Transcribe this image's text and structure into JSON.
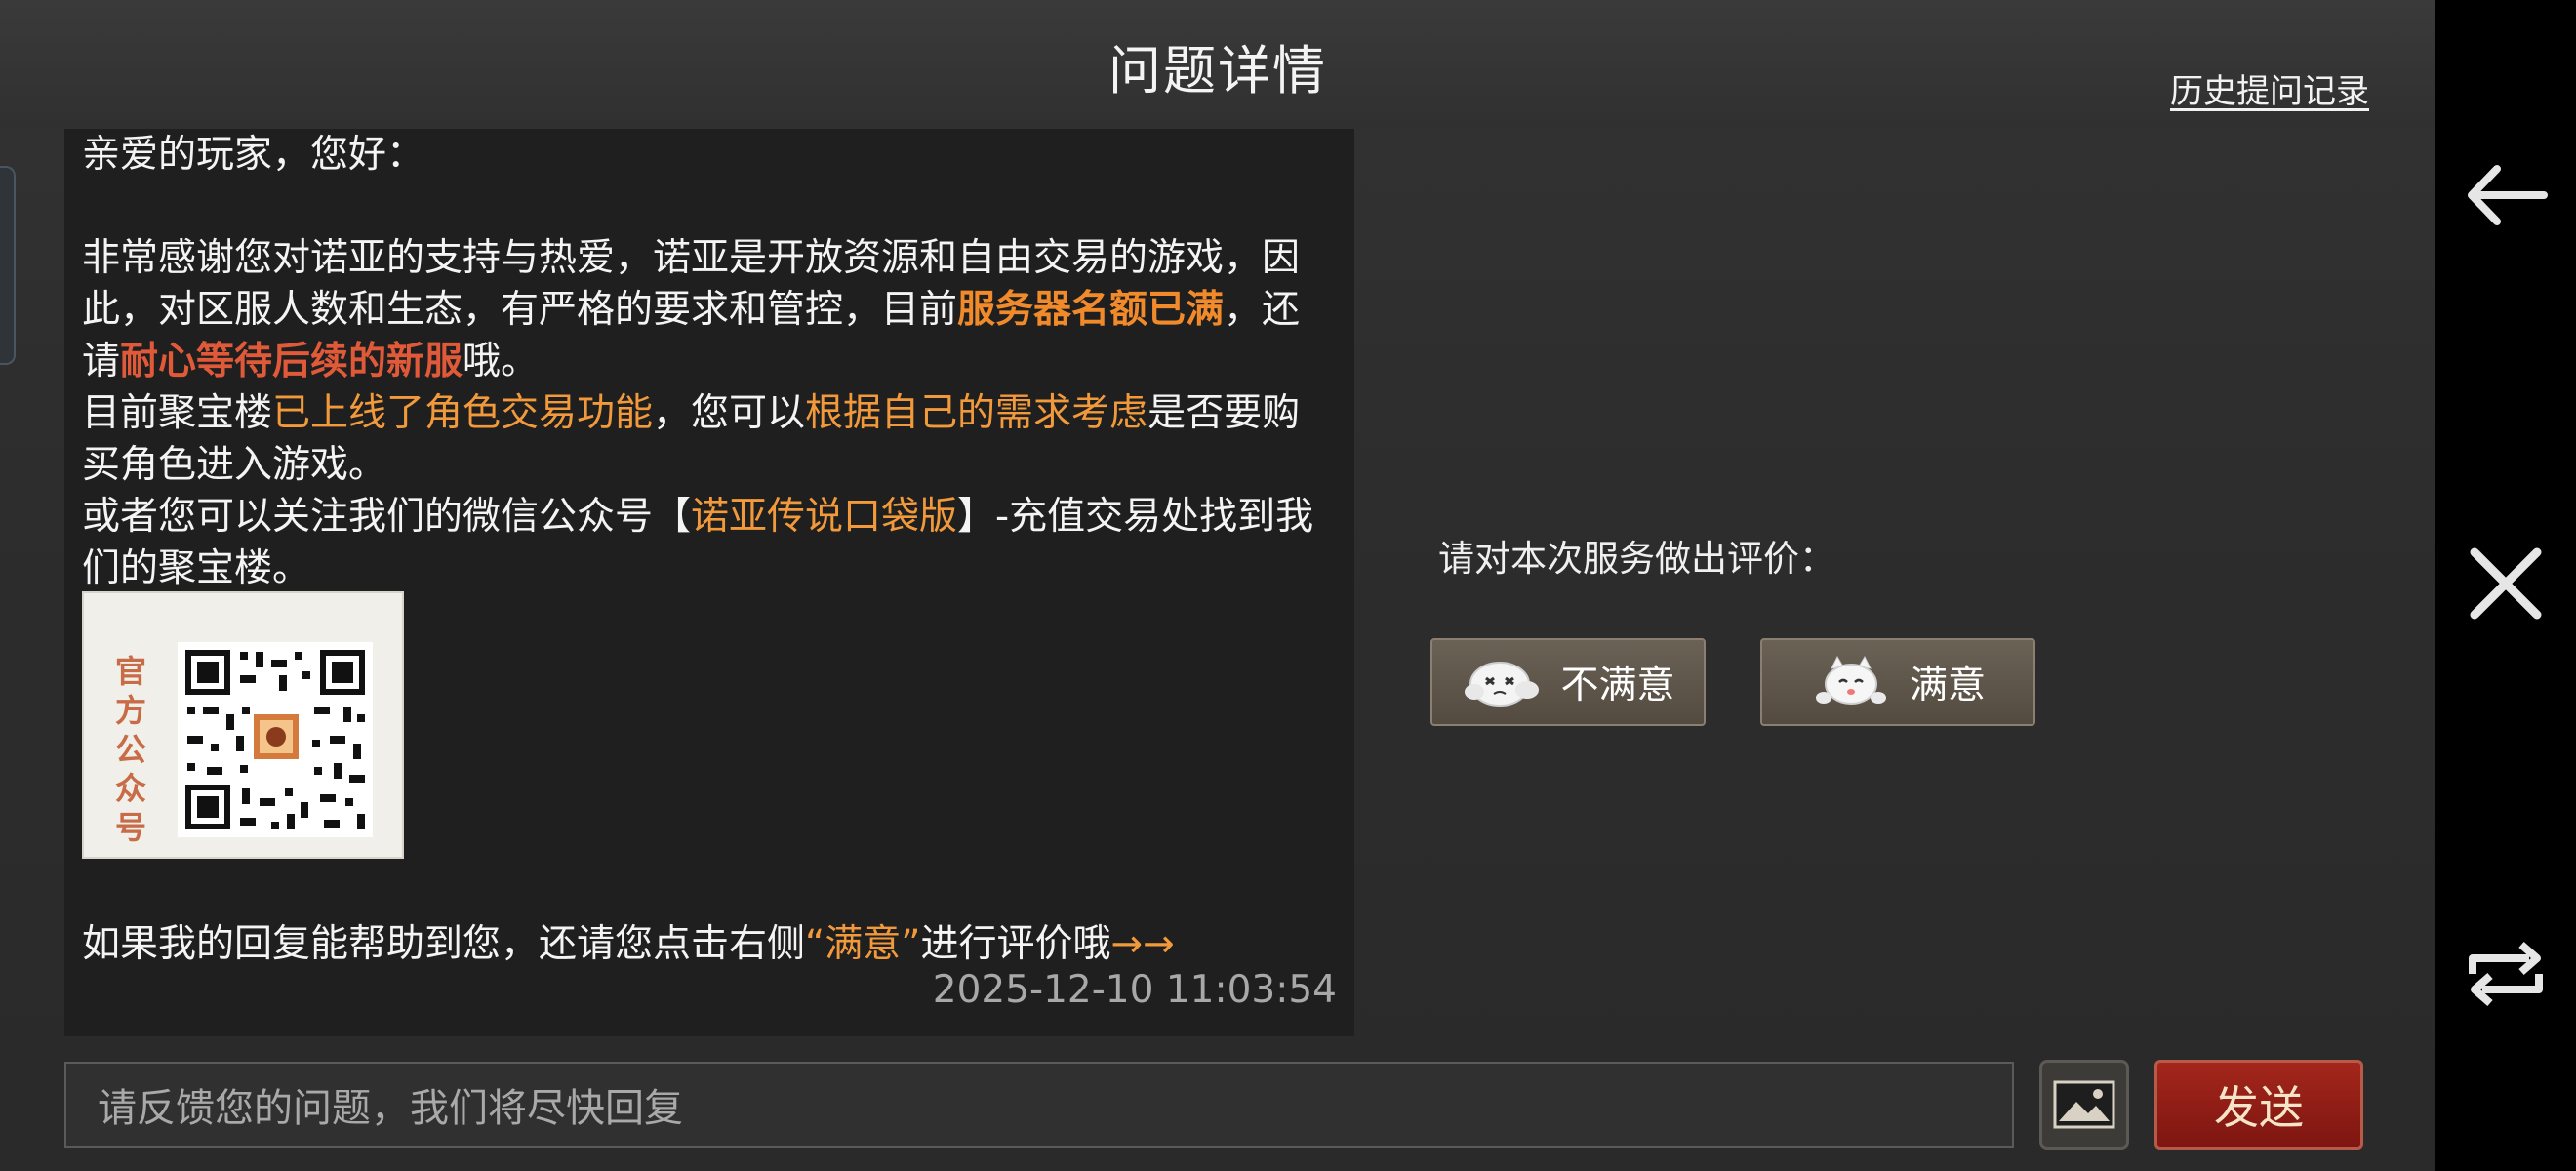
{
  "header": {
    "title": "问题详情",
    "history_link": "历史提问记录"
  },
  "message": {
    "greeting": "亲爱的玩家，您好：",
    "p1_a": "非常感谢您对诺亚的支持与热爱，诺亚是开放资源和自由交易的游戏，因此，对区服人数和生态，有严格的要求和管控，目前",
    "p1_b": "服务器名额已满",
    "p1_c": "，还请",
    "p1_d": "耐心等待后续的新服",
    "p1_e": "哦。",
    "p2_a": "目前聚宝楼",
    "p2_b": "已上线了角色交易功能",
    "p2_c": "，您可以",
    "p2_d": "根据自己的需求考虑",
    "p2_e": "是否要购买角色进入游戏。",
    "p3_a": "或者您可以关注我们的微信公众号【",
    "p3_b": "诺亚传说口袋版",
    "p3_c": "】-充值交易处找到我们的聚宝楼。",
    "qr_label": "官方公众号",
    "closing_a": "如果我的回复能帮助到您，还请您点击右侧",
    "closing_b": "“满意”",
    "closing_c": "进行评价哦",
    "closing_d": "→→",
    "timestamp": "2025-12-10 11:03:54"
  },
  "rating": {
    "label": "请对本次服务做出评价：",
    "unsatisfied": "不满意",
    "satisfied": "满意"
  },
  "input": {
    "placeholder": "请反馈您的问题，我们将尽快回复"
  },
  "send_label": "发送",
  "colors": {
    "highlight_orange": "#f29a3b",
    "highlight_red": "#e05a3a",
    "send_red": "#a3261b"
  }
}
